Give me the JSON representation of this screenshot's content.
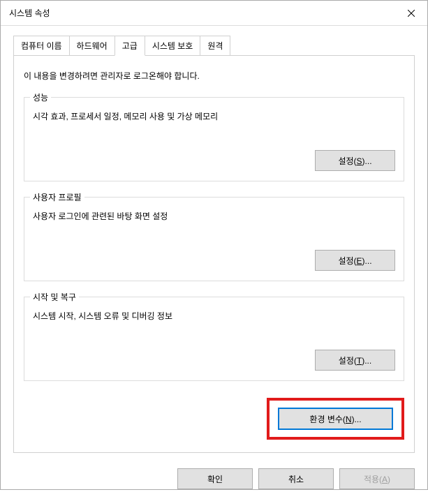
{
  "titlebar": {
    "title": "시스템 속성"
  },
  "tabs": {
    "computer_name": "컴퓨터 이름",
    "hardware": "하드웨어",
    "advanced": "고급",
    "system_protection": "시스템 보호",
    "remote": "원격"
  },
  "panel": {
    "intro": "이 내용을 변경하려면 관리자로 로그온해야 합니다.",
    "performance": {
      "title": "성능",
      "desc": "시각 효과, 프로세서 일정, 메모리 사용 및 가상 메모리",
      "button_prefix": "설정(",
      "button_mnemonic": "S",
      "button_suffix": ")..."
    },
    "user_profile": {
      "title": "사용자 프로필",
      "desc": "사용자 로그인에 관련된 바탕 화면 설정",
      "button_prefix": "설정(",
      "button_mnemonic": "E",
      "button_suffix": ")..."
    },
    "startup": {
      "title": "시작 및 복구",
      "desc": "시스템 시작, 시스템 오류 및 디버깅 정보",
      "button_prefix": "설정(",
      "button_mnemonic": "T",
      "button_suffix": ")..."
    },
    "env_var": {
      "button_prefix": "환경 변수(",
      "button_mnemonic": "N",
      "button_suffix": ")..."
    }
  },
  "bottom": {
    "ok": "확인",
    "cancel": "취소",
    "apply_prefix": "적용(",
    "apply_mnemonic": "A",
    "apply_suffix": ")"
  }
}
